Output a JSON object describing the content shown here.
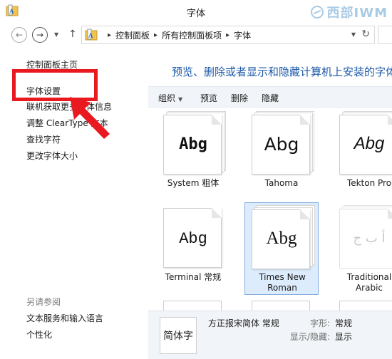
{
  "window": {
    "title": "字体",
    "watermark": "西部IWM"
  },
  "nav": {
    "back_icon": "arrow-left-icon",
    "forward_icon": "arrow-right-icon",
    "up_icon": "arrow-up-icon"
  },
  "address": {
    "breadcrumbs": [
      "控制面板",
      "所有控制面板项",
      "字体"
    ],
    "refresh_icon": "refresh-icon"
  },
  "sidebar": {
    "links": [
      "控制面板主页",
      "字体设置",
      "联机获取更多字体信息",
      "调整 ClearType 文本",
      "查找字符",
      "更改字体大小"
    ],
    "see_also_title": "另请参阅",
    "see_also": [
      "文本服务和输入语言",
      "个性化"
    ],
    "highlight_color": "#e8191f"
  },
  "main": {
    "heading": "预览、删除或者显示和隐藏计算机上安装的字体",
    "toolbar": {
      "organize": "组织",
      "preview": "预览",
      "delete": "删除",
      "hide": "隐藏"
    },
    "fonts": [
      {
        "name": "System 粗体",
        "sample": "Abg"
      },
      {
        "name": "Tahoma",
        "sample": "Abg"
      },
      {
        "name": "Tekton Pro",
        "sample": "Abg"
      },
      {
        "name": "Terminal 常规",
        "sample": "Abg"
      },
      {
        "name": "Times New Roman",
        "sample": "Abg"
      },
      {
        "name": "Traditional Arabic",
        "sample": "أ ب ج"
      }
    ]
  },
  "details": {
    "thumb_text": "简体字",
    "name": "方正报宋简体 常规",
    "style_label": "字形:",
    "style_value": "常规",
    "visibility_label": "显示/隐藏:",
    "visibility_value": "显示"
  }
}
